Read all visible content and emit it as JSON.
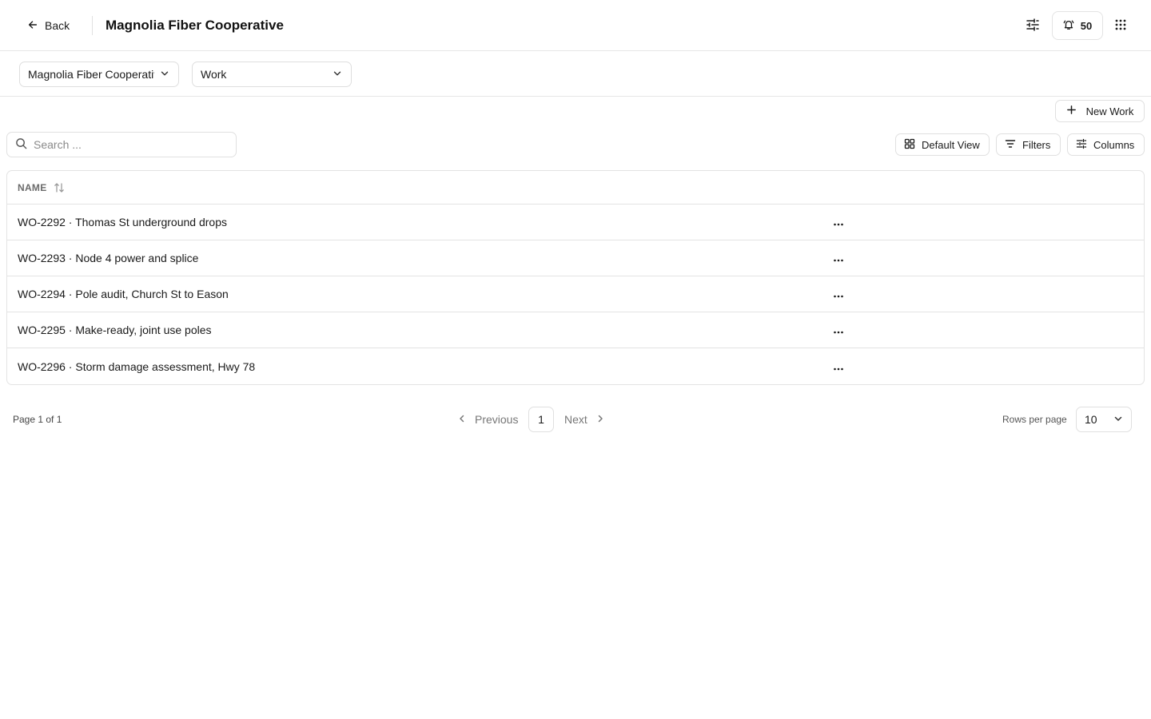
{
  "header": {
    "back_label": "Back",
    "title": "Magnolia Fiber Cooperative",
    "notification_count": "50",
    "icons": [
      "arrow-left-icon",
      "sliders-icon",
      "bell-icon",
      "apps-grid-icon"
    ]
  },
  "selectors": {
    "organization": "Magnolia Fiber Cooperative",
    "record_type": "Work"
  },
  "toolbar": {
    "new_label": "New Work",
    "search_placeholder": "Search ...",
    "view_label": "Default View",
    "filters_label": "Filters",
    "columns_label": "Columns"
  },
  "table": {
    "column_header": "NAME",
    "rows": [
      {
        "name": "WO-2292 · Thomas St underground drops"
      },
      {
        "name": "WO-2293 · Node 4 power and splice"
      },
      {
        "name": "WO-2294 · Pole audit, Church St to Eason"
      },
      {
        "name": "WO-2295 · Make-ready, joint use poles"
      },
      {
        "name": "WO-2296 · Storm damage assessment, Hwy 78"
      }
    ]
  },
  "pagination": {
    "page_info": "Page 1 of 1",
    "previous_label": "Previous",
    "current_page": "1",
    "next_label": "Next",
    "rows_per_page_label": "Rows per page",
    "rows_per_page_value": "10"
  }
}
